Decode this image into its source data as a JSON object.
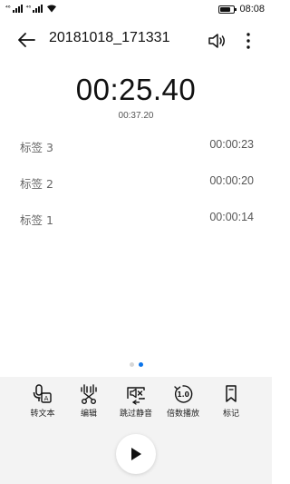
{
  "status_bar": {
    "signal1_label": "⁴⁶",
    "signal2_label": "⁴⁶",
    "battery_level_percent": 90,
    "time": "08:08"
  },
  "header": {
    "title": "20181018_171331",
    "back_icon": "arrow-left-icon",
    "speaker_icon": "speaker-icon",
    "more_icon": "more-vertical-icon"
  },
  "player": {
    "current_time": "00:25.40",
    "total_time": "00:37.20"
  },
  "marks": [
    {
      "label": "标签 3",
      "time": "00:00:23"
    },
    {
      "label": "标签 2",
      "time": "00:00:20"
    },
    {
      "label": "标签 1",
      "time": "00:00:14"
    }
  ],
  "pager": {
    "count": 2,
    "active_index": 1,
    "active_color": "#0a74ea"
  },
  "toolbar": {
    "items": [
      {
        "label": "转文本",
        "icon": "speech-to-text-icon"
      },
      {
        "label": "编辑",
        "icon": "scissors-edit-icon"
      },
      {
        "label": "跳过静音",
        "icon": "skip-silence-icon"
      },
      {
        "label": "倍数播放",
        "icon": "playback-speed-icon"
      },
      {
        "label": "标记",
        "icon": "bookmark-icon"
      }
    ]
  },
  "play_button": {
    "icon": "play-icon"
  }
}
